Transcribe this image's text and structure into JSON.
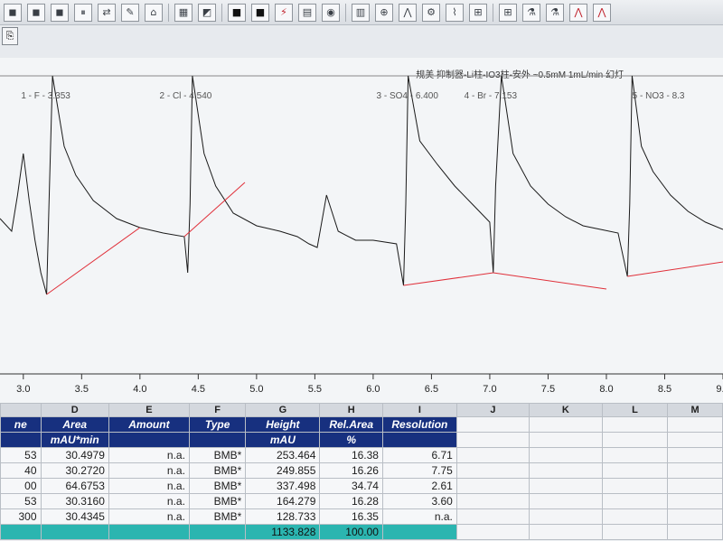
{
  "toolbar": {
    "icons": [
      "layout-icon",
      "chart-icon",
      "black-square-icon",
      "black-square-icon",
      "integration-icon",
      "grid-icon",
      "color-icon",
      "calendar-icon",
      "zoom-icon",
      "peak-icon",
      "tools-icon",
      "baseline-icon",
      "tile-icon",
      "tile-icon",
      "flask-icon",
      "flask-icon",
      "peak-red-icon",
      "peak-red-icon"
    ]
  },
  "chart": {
    "title": "规美 抑制器-Li柱-IO3柱-安外 ~0.5mM 1mL/min 幻灯",
    "peaks": [
      {
        "label": "1 - F - 3.353",
        "time": 3.353
      },
      {
        "label": "2 - Cl - 4.540",
        "time": 4.54
      },
      {
        "label": "3 - SO4 - 6.400",
        "time": 6.4
      },
      {
        "label": "4 - Br - 7.153",
        "time": 7.153
      },
      {
        "label": "5 - NO3 - 8.3",
        "time": 8.3
      }
    ],
    "xticks": [
      "3.0",
      "3.5",
      "4.0",
      "4.5",
      "5.0",
      "5.5",
      "6.0",
      "6.5",
      "7.0",
      "7.5",
      "8.0",
      "8.5",
      "9.0"
    ]
  },
  "chart_data": {
    "type": "line",
    "title": "规美 抑制器-Li柱-IO3柱-安外 ~0.5mM 1mL/min 幻灯",
    "xlabel": "",
    "ylabel": "",
    "xlim": [
      2.8,
      9.0
    ],
    "grid": false,
    "series": [
      {
        "x": [
          2.8,
          2.9,
          2.95,
          3.0,
          3.05,
          3.1,
          3.15,
          3.2,
          3.22,
          3.25,
          3.35,
          3.45,
          3.6,
          3.8,
          4.0,
          4.2,
          4.38,
          4.41,
          4.43,
          4.45,
          4.55,
          4.65,
          4.8,
          5.0,
          5.2,
          5.35,
          5.45,
          5.52,
          5.6,
          5.7,
          5.85,
          6.0,
          6.2,
          6.26,
          6.28,
          6.3,
          6.4,
          6.55,
          6.7,
          6.85,
          7.0,
          7.03,
          7.05,
          7.1,
          7.2,
          7.35,
          7.5,
          7.65,
          7.8,
          7.95,
          8.1,
          8.18,
          8.2,
          8.22,
          8.3,
          8.4,
          8.55,
          8.7,
          8.85,
          9.0
        ],
        "y": [
          0.42,
          0.35,
          0.55,
          0.78,
          0.52,
          0.3,
          0.12,
          0.0,
          0.5,
          1.0,
          0.82,
          0.66,
          0.52,
          0.42,
          0.37,
          0.34,
          0.32,
          0.12,
          0.5,
          1.0,
          0.78,
          0.6,
          0.45,
          0.38,
          0.35,
          0.32,
          0.28,
          0.26,
          0.55,
          0.35,
          0.3,
          0.3,
          0.28,
          0.05,
          0.5,
          1.0,
          0.85,
          0.72,
          0.6,
          0.5,
          0.4,
          0.12,
          0.6,
          1.0,
          0.78,
          0.6,
          0.5,
          0.43,
          0.38,
          0.36,
          0.34,
          0.1,
          0.5,
          1.0,
          0.82,
          0.68,
          0.55,
          0.46,
          0.4,
          0.36
        ]
      }
    ]
  },
  "sheet": {
    "cols": [
      "",
      "D",
      "E",
      "F",
      "G",
      "H",
      "I",
      "J",
      "K",
      "L",
      "M"
    ],
    "headers": [
      {
        "l1": "ne",
        "l2": ""
      },
      {
        "l1": "Area",
        "l2": "mAU*min"
      },
      {
        "l1": "Amount",
        "l2": ""
      },
      {
        "l1": "Type",
        "l2": ""
      },
      {
        "l1": "Height",
        "l2": "mAU"
      },
      {
        "l1": "Rel.Area",
        "l2": "%"
      },
      {
        "l1": "Resolution",
        "l2": ""
      }
    ],
    "rows": [
      [
        "53",
        "30.4979",
        "n.a.",
        "BMB*",
        "253.464",
        "16.38",
        "6.71"
      ],
      [
        "40",
        "30.2720",
        "n.a.",
        "BMB*",
        "249.855",
        "16.26",
        "7.75"
      ],
      [
        "00",
        "64.6753",
        "n.a.",
        "BMB*",
        "337.498",
        "34.74",
        "2.61"
      ],
      [
        "53",
        "30.3160",
        "n.a.",
        "BMB*",
        "164.279",
        "16.28",
        "3.60"
      ],
      [
        "300",
        "30.4345",
        "n.a.",
        "BMB*",
        "128.733",
        "16.35",
        "n.a."
      ]
    ],
    "totals": [
      "",
      "",
      "",
      "",
      "1133.828",
      "100.00",
      ""
    ]
  }
}
